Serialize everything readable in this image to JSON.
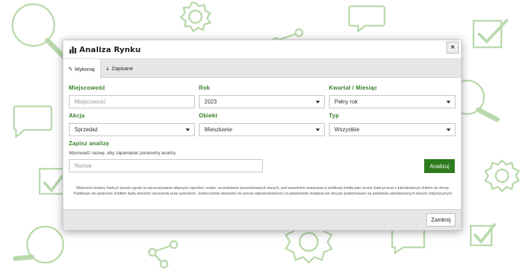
{
  "modal": {
    "title": "Analiza Rynku",
    "close_symbol": "×",
    "icon": "bar-chart-icon"
  },
  "tabs": [
    {
      "label": "Wykonaj",
      "icon": "bolt-icon",
      "active": true
    },
    {
      "label": "Zapisane",
      "icon": "download-icon",
      "active": false
    }
  ],
  "form": {
    "city": {
      "label": "Miejscowość",
      "placeholder": "Miejscowość",
      "value": ""
    },
    "year": {
      "label": "Rok",
      "value": "2023"
    },
    "period": {
      "label": "Kwartał / Miesiąc",
      "value": "Pełny rok"
    },
    "action": {
      "label": "Akcja",
      "value": "Sprzedaż"
    },
    "object": {
      "label": "Obiekt",
      "value": "Mieszkanie"
    },
    "type": {
      "label": "Typ",
      "value": "Wszystkie"
    },
    "save": {
      "label": "Zapisz analizę",
      "help": "Wprowadź nazwę, aby zapamiętać parametry analizy.",
      "placeholder": "Nazwa"
    },
    "run_button": "Analizuj"
  },
  "disclaimer": "Właściciel serwisu Sads.pl wyraża zgodę na opracowywanie własnych raportów i analiz, na podstawie prezentowanych danych, pod warunkiem wskazania w publikacji źródła jako serwis Sads.pl wraz z interaktywnym linkiem do strony. Publikacje nie opatrzone źródłem będą stanowić naruszenie praw autorskich. Jednocześnie właściciel nie ponosi odpowiedzialności za jakiekolwiek działania lub decyzje podejmowane na podstawie udostępnionych danych statystycznych",
  "footer": {
    "close_label": "Zamknij"
  },
  "colors": {
    "accent": "#2e7a1e",
    "label": "#2d7a1f",
    "decoration": "#b9d9ac"
  }
}
